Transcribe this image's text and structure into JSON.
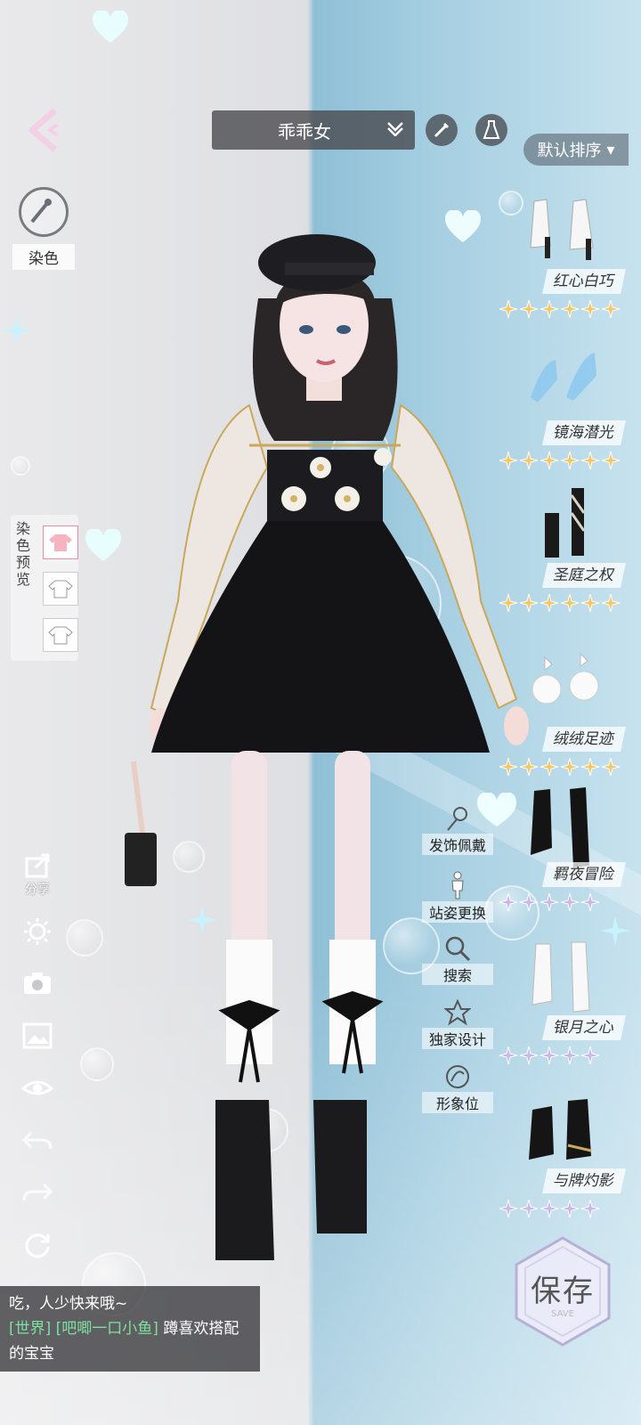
{
  "header": {
    "outfit_name": "乖乖女",
    "sort_label": "默认排序"
  },
  "left_tools": {
    "dye_label": "染色",
    "dye_preview_label": "染色预览",
    "share_label": "分享"
  },
  "items": [
    {
      "name": "红心白巧",
      "stars": 6,
      "star_color": "#f2c866"
    },
    {
      "name": "镜海潜光",
      "stars": 6,
      "star_color": "#f2c866"
    },
    {
      "name": "圣庭之权",
      "stars": 6,
      "star_color": "#f2c866"
    },
    {
      "name": "绒绒足迹",
      "stars": 6,
      "star_color": "#f2c866"
    },
    {
      "name": "羁夜冒险",
      "stars": 5,
      "star_color": "#c8b8ec"
    },
    {
      "name": "银月之心",
      "stars": 5,
      "star_color": "#c8b8ec"
    },
    {
      "name": "与牌灼影",
      "stars": 5,
      "star_color": "#c8b8ec"
    }
  ],
  "mid_tools": {
    "hair_accessory": "发饰佩戴",
    "pose": "站姿更换",
    "search": "搜索",
    "exclusive": "独家设计",
    "avatar": "形象位"
  },
  "chat": {
    "line1": "吃，人少快来哦~",
    "channel": "[世界]",
    "user": "[吧唧一口小鱼]",
    "message": "蹲喜欢搭配的宝宝"
  },
  "save": {
    "label": "保存",
    "sub_label": "SAVE"
  }
}
